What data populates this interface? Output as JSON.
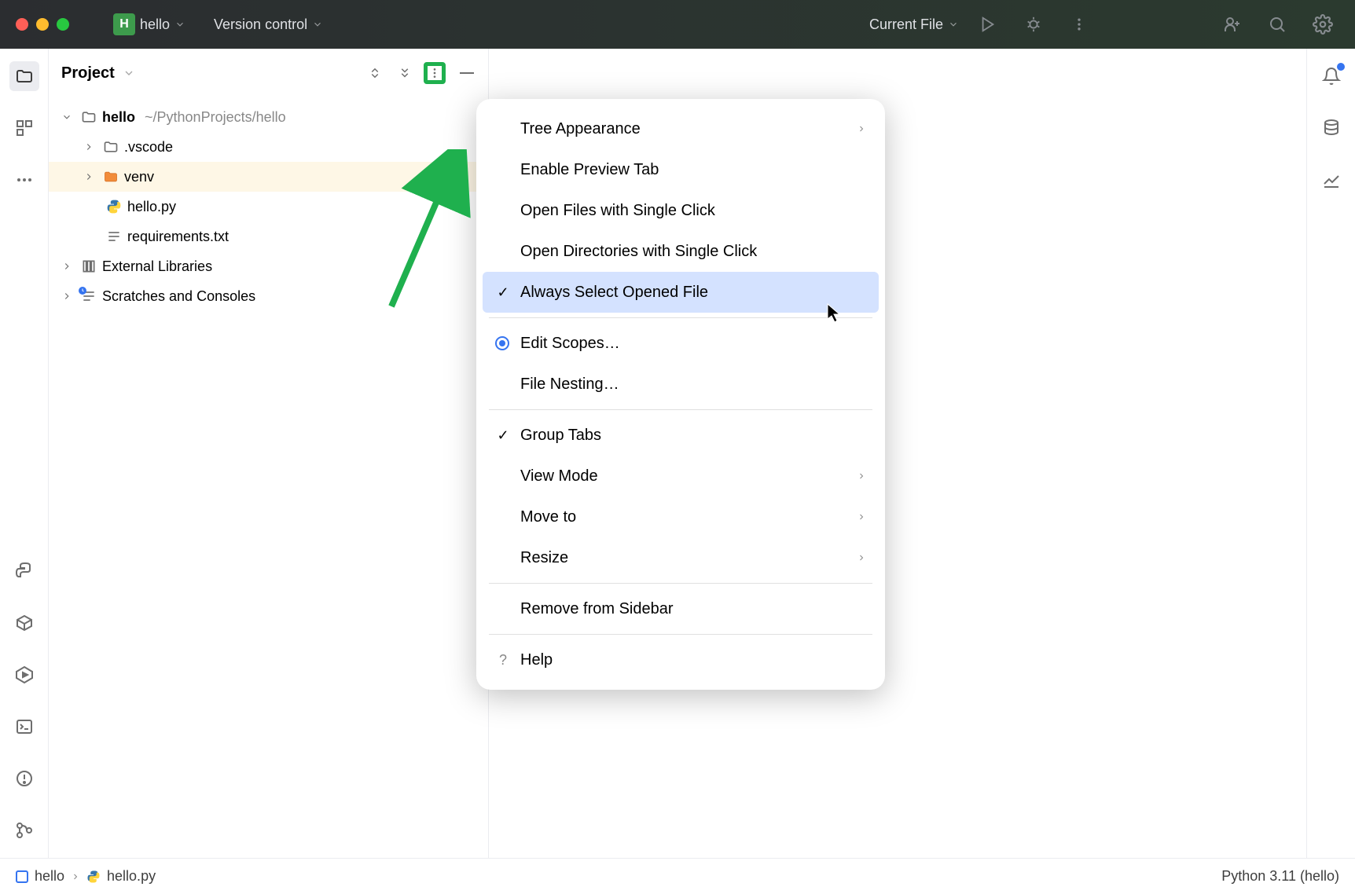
{
  "titlebar": {
    "project_name": "hello",
    "project_badge": "H",
    "vcs": "Version control",
    "run_config": "Current File"
  },
  "sidebar": {
    "title": "Project",
    "tree": {
      "root_name": "hello",
      "root_path": "~/PythonProjects/hello",
      "vscode": ".vscode",
      "venv": "venv",
      "hello_py": "hello.py",
      "requirements": "requirements.txt",
      "ext_libs": "External Libraries",
      "scratches": "Scratches and Consoles"
    }
  },
  "context_menu": {
    "tree_appearance": "Tree Appearance",
    "enable_preview": "Enable Preview Tab",
    "open_files_single": "Open Files with Single Click",
    "open_dirs_single": "Open Directories with Single Click",
    "always_select": "Always Select Opened File",
    "edit_scopes": "Edit Scopes…",
    "file_nesting": "File Nesting…",
    "group_tabs": "Group Tabs",
    "view_mode": "View Mode",
    "move_to": "Move to",
    "resize": "Resize",
    "remove_sidebar": "Remove from Sidebar",
    "help": "Help"
  },
  "statusbar": {
    "crumb_root": "hello",
    "crumb_file": "hello.py",
    "interpreter": "Python 3.11 (hello)"
  }
}
